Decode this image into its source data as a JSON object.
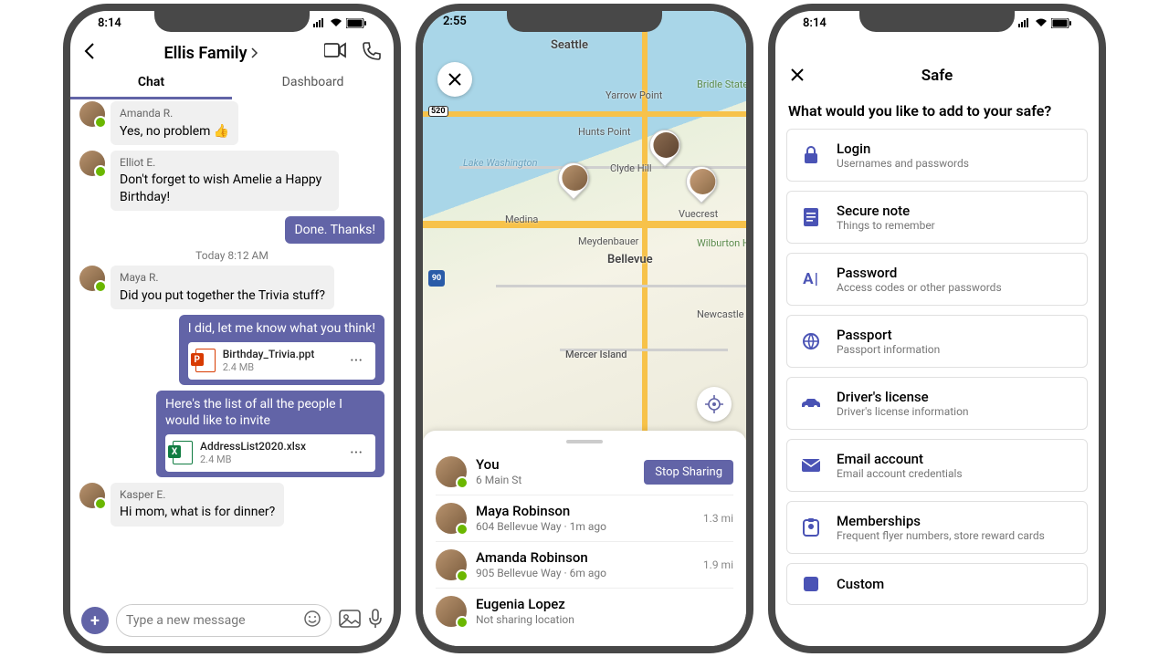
{
  "status": {
    "time": "8:14"
  },
  "chat": {
    "header_title": "Ellis Family",
    "tab_chat": "Chat",
    "tab_dash": "Dashboard",
    "messages": [
      {
        "sender": "Amanda R.",
        "text": "Yes, no problem 👍",
        "mine": false
      },
      {
        "sender": "Elliot E.",
        "text": "Don't forget to wish Amelie a Happy Birthday!",
        "mine": false
      },
      {
        "text": "Done. Thanks!",
        "mine": true
      },
      {
        "sep": "Today 8:12 AM"
      },
      {
        "sender": "Maya R.",
        "text": "Did you put together the Trivia stuff?",
        "mine": false
      },
      {
        "text": "I did, let me know what you think!",
        "mine": true,
        "attach": {
          "name": "Birthday_Trivia.ppt",
          "size": "2.4 MB",
          "kind": "ppt"
        }
      },
      {
        "text": "Here's the list of all the people I would like to invite",
        "mine": true,
        "attach": {
          "name": "AddressList2020.xlsx",
          "size": "2.4 MB",
          "kind": "xls"
        }
      },
      {
        "sender": "Kasper E.",
        "text": "Hi mom, what is for dinner?",
        "mine": false
      }
    ],
    "composer_placeholder": "Type a new message"
  },
  "map": {
    "time_overlay": "2:55",
    "labels": {
      "seattle": "Seattle",
      "bellevue": "Bellevue",
      "mercer": "Mercer Island",
      "lake": "Lake Washington",
      "clyde": "Clyde Hill",
      "hunts": "Hunts Point",
      "yarrow": "Yarrow Point",
      "medina": "Medina",
      "vuecrest": "Vuecrest",
      "wilburton": "Wilburton Hill Park",
      "bridle": "Bridle State",
      "newcastle": "Newcastle",
      "meydenbauer": "Meydenbauer"
    },
    "sheet": {
      "stop_label": "Stop Sharing",
      "people": [
        {
          "name": "You",
          "sub": "6 Main St",
          "dist": "",
          "me": true
        },
        {
          "name": "Maya Robinson",
          "sub": "604 Bellevue Way · 1m ago",
          "dist": "1.3 mi",
          "me": false
        },
        {
          "name": "Amanda Robinson",
          "sub": "905 Bellevue Way · 6m ago",
          "dist": "1.9 mi",
          "me": false
        },
        {
          "name": "Eugenia Lopez",
          "sub": "Not sharing location",
          "dist": "",
          "me": false
        }
      ]
    }
  },
  "safe": {
    "title": "Safe",
    "question": "What would you like to add to your safe?",
    "items": [
      {
        "icon": "lock-icon",
        "title": "Login",
        "sub": "Usernames and passwords"
      },
      {
        "icon": "note-icon",
        "title": "Secure note",
        "sub": "Things to remember"
      },
      {
        "icon": "letter-a-icon",
        "title": "Password",
        "sub": "Access codes or other passwords"
      },
      {
        "icon": "globe-icon",
        "title": "Passport",
        "sub": "Passport information"
      },
      {
        "icon": "car-icon",
        "title": "Driver's license",
        "sub": "Driver's license information"
      },
      {
        "icon": "mail-icon",
        "title": "Email account",
        "sub": "Email account credentials"
      },
      {
        "icon": "badge-icon",
        "title": "Memberships",
        "sub": "Frequent flyer numbers, store reward cards"
      },
      {
        "icon": "custom-icon",
        "title": "Custom",
        "sub": ""
      }
    ]
  }
}
